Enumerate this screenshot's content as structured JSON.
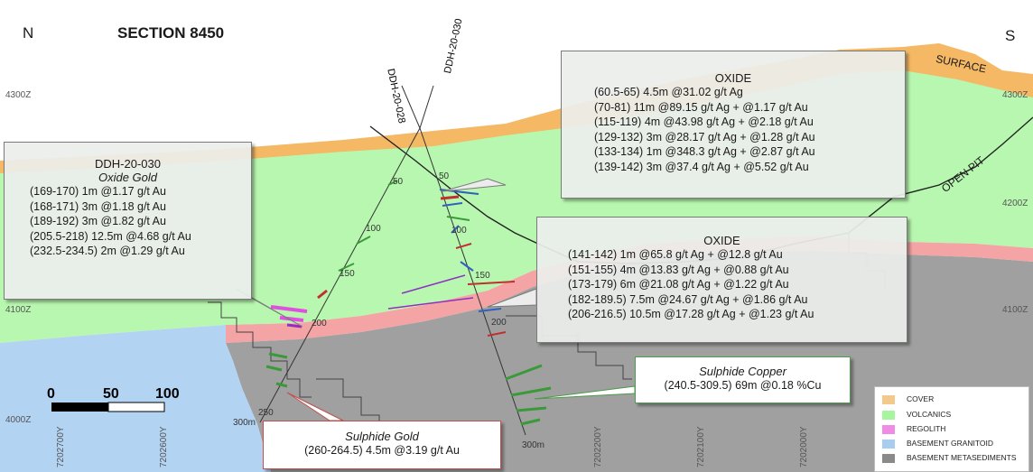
{
  "header": {
    "north": "N",
    "south": "S",
    "section_title": "SECTION 8450"
  },
  "surface_label": "SURFACE",
  "open_pit_label": "OPEN PIT",
  "elevations_left": [
    "4300Z",
    "4100Z",
    "4000Z"
  ],
  "elevations_right": [
    "4300Z",
    "4200Z",
    "4100Z"
  ],
  "eastings": [
    "7202700Y",
    "7202600Y",
    "7202200Y",
    "7202100Y",
    "7202000Y"
  ],
  "drillholes": {
    "names": [
      "DDH-20-028",
      "DDH-20-030"
    ],
    "depth_ticks_left": [
      "50",
      "100",
      "150",
      "200",
      "250"
    ],
    "depth_ticks_right": [
      "50",
      "100",
      "150",
      "200"
    ],
    "end_left": "300m",
    "end_right": "300m"
  },
  "scale_bar": {
    "labels": [
      "0",
      "50",
      "100"
    ]
  },
  "callouts": {
    "ddh030": {
      "title": "DDH-20-030",
      "subtitle": "Oxide Gold",
      "lines": [
        "(169-170) 1m @1.17 g/t Au",
        "(168-171) 3m @1.18 g/t Au",
        "(189-192) 3m @1.82 g/t Au",
        "(205.5-218) 12.5m @4.68 g/t Au",
        "(232.5-234.5) 2m @1.29 g/t Au"
      ]
    },
    "oxide_top": {
      "title": "OXIDE",
      "lines": [
        "(60.5-65) 4.5m @31.02 g/t Ag",
        "(70-81) 11m @89.15 g/t Ag   + @1.17 g/t Au",
        "(115-119) 4m @43.98 g/t Ag + @2.18 g/t Au",
        "(129-132) 3m @28.17 g/t Ag + @1.28 g/t Au",
        "(133-134) 1m @348.3 g/t Ag + @2.87 g/t Au",
        "(139-142) 3m @37.4 g/t Ag   + @5.52 g/t Au"
      ]
    },
    "oxide_mid": {
      "title": "OXIDE",
      "lines": [
        "(141-142) 1m @65.8 g/t Ag   + @12.8 g/t Au",
        "(151-155) 4m @13.83 g/t Ag + @0.88 g/t Au",
        "(173-179) 6m @21.08 g/t Ag + @1.22 g/t Au",
        "(182-189.5) 7.5m @24.67 g/t Ag + @1.86 g/t Au",
        "(206-216.5) 10.5m @17.28 g/t Ag + @1.23 g/t Au"
      ]
    },
    "sulphide_copper": {
      "title": "Sulphide Copper",
      "lines": [
        "(240.5-309.5) 69m @0.18 %Cu"
      ]
    },
    "sulphide_gold": {
      "title": "Sulphide Gold",
      "lines": [
        "(260-264.5) 4.5m @3.19 g/t Au"
      ]
    }
  },
  "legend": [
    {
      "label": "COVER",
      "color": "#f2c98a"
    },
    {
      "label": "VOLCANICS",
      "color": "#a8f5a0"
    },
    {
      "label": "REGOLITH",
      "color": "#f08ce8"
    },
    {
      "label": "BASEMENT GRANITOID",
      "color": "#a9cdf0"
    },
    {
      "label": "BASEMENT METASEDIMENTS",
      "color": "#8a8a8a"
    }
  ],
  "colors": {
    "cover": "#f5b865",
    "volcanics": "#b8f7b0",
    "regolith": "#f4a4a4",
    "granitoid": "#b3d3f2",
    "metasediments": "#a0a0a0",
    "callout_border_red": "#c0504d",
    "callout_border_green": "#4e9a4e"
  }
}
